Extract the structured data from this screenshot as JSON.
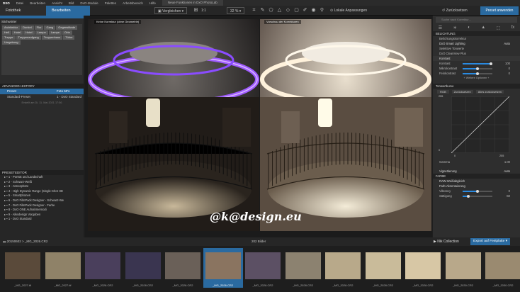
{
  "menu": [
    "Datei",
    "Bearbeiten",
    "Ansicht",
    "Bild",
    "DxO-Module",
    "Paletten",
    "Arbeitsbereich",
    "Hilfe"
  ],
  "window_title": "Neue Funktionen in DxO PhotoLab",
  "tabs": {
    "library": "Fotothek",
    "edit": "Bearbeiten"
  },
  "toolbar": {
    "compare": "Vergleichen",
    "ratio": "1:1",
    "zoom": "32 %",
    "local_adjust": "Lokale Anpassungen",
    "reset": "Zurücksetzen",
    "apply_preset": "Preset anwenden"
  },
  "keywords": {
    "title": "Stichwörter",
    "items": [
      "Architektur",
      "Dunkel",
      "Flur",
      "Gang",
      "Gegenstände",
      "Hell",
      "Hotel",
      "Hotel",
      "Lampe",
      "Lampe",
      "Orte",
      "Treppe",
      "Treppenaufgang",
      "Treppenhaus",
      "Türke",
      "Umgebung"
    ]
  },
  "history": {
    "title": "ADVANCED HISTORY",
    "rows": [
      {
        "name": "Preset",
        "value": "Foto 60's"
      },
      {
        "name": "Standard-Preset",
        "value": "1 - DxO Standard"
      }
    ],
    "date": "Erstellt am Di, 11. Mai 2021 17:56"
  },
  "preset_editor": {
    "title": "PRESETEDITOR",
    "items": [
      "1 - Porträt und Landschaft",
      "2 - Schwarz-Weiß",
      "3 - Atmosphäre",
      "4 - High Dynamic Range (Single-Shot HD",
      "5 - Smartphones",
      "6 - DxO FilmPack Designer - Schwarz-We",
      "7 - DxO FilmPack Designer - Farbe",
      "8 - DxO ONE Aufnahmemodi",
      "9 - Alkedesign Vorgaben",
      "1 - DxO Standard"
    ]
  },
  "viewer": {
    "left_label": "Keine Korrektur (ohne Geometrie)",
    "right_label": "Vorschau der Korrekturen",
    "watermark": "@k@design.eu"
  },
  "right_panel": {
    "search": "Suche nach Korrektur...",
    "sections": {
      "lighting": "BELICHTUNG",
      "tone_curve": "Tonwertkurve",
      "color": "FARBE"
    },
    "rows": {
      "exposure": "Belichtungskorrektur",
      "smart_lighting": "DxO Smart Lighting",
      "smart_value": "Auto",
      "selective": "Selektive Tonwerte",
      "clearview": "DxO ClearView Plus",
      "contrast": "Kontrast"
    },
    "sliders": [
      {
        "label": "Kontrast",
        "value": "100",
        "pct": 0.95
      },
      {
        "label": "Mikrokontrast",
        "value": "0",
        "pct": 0.5
      },
      {
        "label": "Feinkontrast",
        "value": "0",
        "pct": 0.5
      }
    ],
    "more": "+ Weitere Optionen +",
    "curve": {
      "channel": "RGB",
      "reset": "Zurücksetzen",
      "reset_all": "Alles zurücksetzen",
      "top": "255",
      "bottom": "0",
      "in_min": "0",
      "in_max": "255",
      "gamma_label": "Gamma",
      "gamma_value": "1.00"
    },
    "vignetting": "Vignettierung",
    "vignetting_value": "Auto",
    "color_rows": [
      {
        "label": "RAW-Weißabgleich"
      },
      {
        "label": "Farb-Akzentuierung"
      }
    ],
    "vib": [
      {
        "label": "Vibrancy",
        "value": "0",
        "pct": 0.5
      },
      {
        "label": "Sättigung",
        "value": "-60",
        "pct": 0.2
      }
    ]
  },
  "strip": {
    "folder": "20150602 > _MG_2026.CR2",
    "count": "202 Bilder",
    "nik": "Nik Collection",
    "export": "Export auf Festplatte"
  },
  "thumbs": [
    "_MG_2027.tif",
    "_MG_2027.tif",
    "_MG_2028.CR2",
    "_MG_2028.CR2",
    "_MG_2028.CR2",
    "_MG_2026.CR2",
    "_MG_2028.CR2",
    "_MG_2028.CR2",
    "_MG_2028.CR2",
    "_MG_2028.CR2",
    "_MG_2028.CR2",
    "_MG_2030.CR2",
    "_MG_2030.CR2"
  ],
  "colors": {
    "accent": "#2a6aa0",
    "purple_glow": "#8a4cff"
  }
}
